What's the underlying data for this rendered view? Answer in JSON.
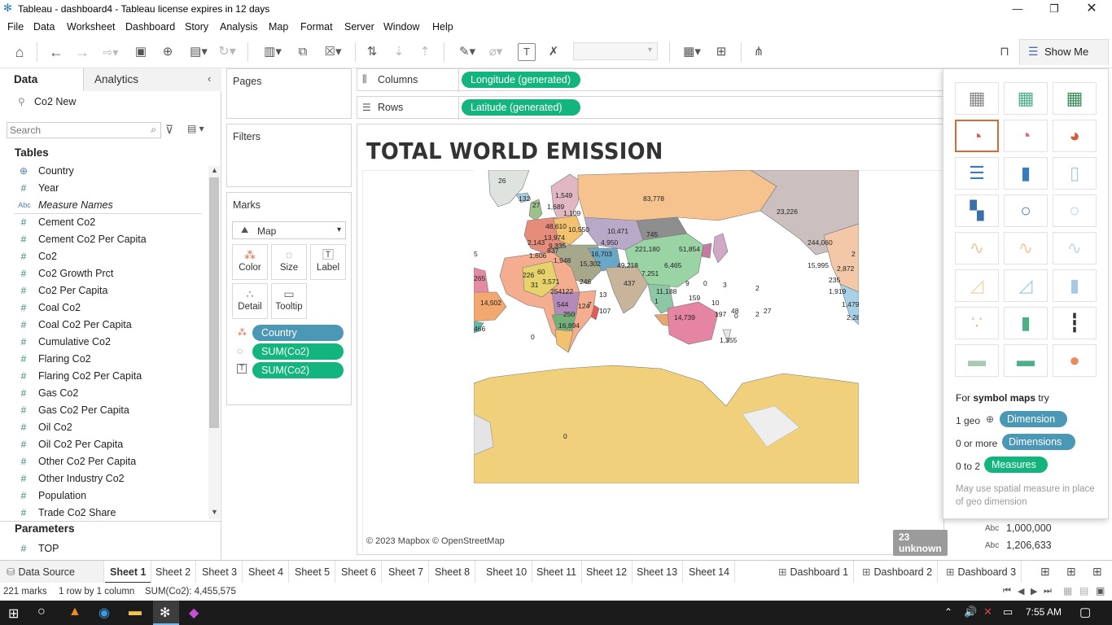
{
  "window": {
    "title": "Tableau - dashboard4 - Tableau license expires in 12 days"
  },
  "menu": [
    "File",
    "Data",
    "Worksheet",
    "Dashboard",
    "Story",
    "Analysis",
    "Map",
    "Format",
    "Server",
    "Window",
    "Help"
  ],
  "toolbar": {
    "show_me": "Show Me"
  },
  "data_pane": {
    "tab_data": "Data",
    "tab_analytics": "Analytics",
    "source": "Co2 New",
    "search_placeholder": "Search",
    "tables_header": "Tables",
    "fields": [
      {
        "type": "geo",
        "icon": "⊕",
        "name": "Country"
      },
      {
        "type": "num",
        "icon": "#",
        "name": "Year"
      },
      {
        "type": "abc",
        "icon": "Abc",
        "name": "Measure Names"
      },
      {
        "type": "num",
        "icon": "#",
        "name": "Cement Co2"
      },
      {
        "type": "num",
        "icon": "#",
        "name": "Cement Co2 Per Capita"
      },
      {
        "type": "num",
        "icon": "#",
        "name": "Co2"
      },
      {
        "type": "num",
        "icon": "#",
        "name": "Co2 Growth Prct"
      },
      {
        "type": "num",
        "icon": "#",
        "name": "Co2 Per Capita"
      },
      {
        "type": "num",
        "icon": "#",
        "name": "Coal Co2"
      },
      {
        "type": "num",
        "icon": "#",
        "name": "Coal Co2 Per Capita"
      },
      {
        "type": "num",
        "icon": "#",
        "name": "Cumulative Co2"
      },
      {
        "type": "num",
        "icon": "#",
        "name": "Flaring Co2"
      },
      {
        "type": "num",
        "icon": "#",
        "name": "Flaring Co2 Per Capita"
      },
      {
        "type": "num",
        "icon": "#",
        "name": "Gas Co2"
      },
      {
        "type": "num",
        "icon": "#",
        "name": "Gas Co2 Per Capita"
      },
      {
        "type": "num",
        "icon": "#",
        "name": "Oil Co2"
      },
      {
        "type": "num",
        "icon": "#",
        "name": "Oil Co2 Per Capita"
      },
      {
        "type": "num",
        "icon": "#",
        "name": "Other Co2 Per Capita"
      },
      {
        "type": "num",
        "icon": "#",
        "name": "Other Industry Co2"
      },
      {
        "type": "num",
        "icon": "#",
        "name": "Population"
      },
      {
        "type": "num",
        "icon": "#",
        "name": "Trade Co2 Share"
      }
    ],
    "parameters_header": "Parameters",
    "parameters": [
      {
        "icon": "#",
        "name": "TOP"
      }
    ]
  },
  "cards": {
    "pages": "Pages",
    "filters": "Filters",
    "marks": "Marks",
    "mark_type": "Map",
    "mark_buttons": [
      "Color",
      "Size",
      "Label",
      "Detail",
      "Tooltip"
    ],
    "mark_pills": [
      {
        "icon": "color",
        "label": "Country",
        "kind": "dimension"
      },
      {
        "icon": "size",
        "label": "SUM(Co2)",
        "kind": "measure"
      },
      {
        "icon": "label",
        "label": "SUM(Co2)",
        "kind": "measure"
      }
    ]
  },
  "shelves": {
    "columns_label": "Columns",
    "columns_pill": "Longitude (generated)",
    "rows_label": "Rows",
    "rows_pill": "Latitude (generated)"
  },
  "view": {
    "title": "TOTAL WORLD EMISSION",
    "attribution": "© 2023 Mapbox © OpenStreetMap",
    "unknown_badge": "23 unknown",
    "map_labels": [
      {
        "text": "26"
      },
      {
        "text": "132"
      },
      {
        "text": "27"
      },
      {
        "text": "1,689"
      },
      {
        "text": "1,549"
      },
      {
        "text": "1,109"
      },
      {
        "text": "83,778"
      },
      {
        "text": "23,226"
      },
      {
        "text": "48,610"
      },
      {
        "text": "10,550"
      },
      {
        "text": "13,974"
      },
      {
        "text": "2,143"
      },
      {
        "text": "9,335"
      },
      {
        "text": "10,471"
      },
      {
        "text": "745"
      },
      {
        "text": "4,950"
      },
      {
        "text": "221,180"
      },
      {
        "text": "51,854"
      },
      {
        "text": "244,060"
      },
      {
        "text": "1,606"
      },
      {
        "text": "16,703"
      },
      {
        "text": "15,302"
      },
      {
        "text": "49,218"
      },
      {
        "text": "6,465"
      },
      {
        "text": "15,995"
      },
      {
        "text": "2,872"
      },
      {
        "text": "837"
      },
      {
        "text": "1,948"
      },
      {
        "text": "60"
      },
      {
        "text": "226"
      },
      {
        "text": "3,571"
      },
      {
        "text": "31"
      },
      {
        "text": "246"
      },
      {
        "text": "7,251"
      },
      {
        "text": "437"
      },
      {
        "text": "254"
      },
      {
        "text": "122"
      },
      {
        "text": "13"
      },
      {
        "text": "11,188"
      },
      {
        "text": "9"
      },
      {
        "text": "0"
      },
      {
        "text": "3"
      },
      {
        "text": "235"
      },
      {
        "text": "1,919"
      },
      {
        "text": "265"
      },
      {
        "text": "14,502"
      },
      {
        "text": "544"
      },
      {
        "text": "124"
      },
      {
        "text": "7"
      },
      {
        "text": "1"
      },
      {
        "text": "159"
      },
      {
        "text": "10"
      },
      {
        "text": "2"
      },
      {
        "text": "1,479"
      },
      {
        "text": "250"
      },
      {
        "text": "107"
      },
      {
        "text": "14,739"
      },
      {
        "text": "197"
      },
      {
        "text": "48"
      },
      {
        "text": "0"
      },
      {
        "text": "2"
      },
      {
        "text": "27"
      },
      {
        "text": "2,28"
      },
      {
        "text": "16,894"
      },
      {
        "text": "466"
      },
      {
        "text": "0"
      },
      {
        "text": "1,355"
      },
      {
        "text": "0"
      },
      {
        "text": "5"
      },
      {
        "text": "2"
      }
    ]
  },
  "showme": {
    "hint_prefix": "For ",
    "hint_bold": "symbol maps",
    "hint_suffix": " try",
    "rows": [
      {
        "prefix": "1 geo",
        "pill": "Dimension"
      },
      {
        "prefix": "0 or more",
        "pill": "Dimensions"
      },
      {
        "prefix": "0 to 2",
        "pill": "Measures"
      }
    ],
    "note": "May use spatial measure in place of geo dimension"
  },
  "legend_peek": [
    {
      "icon": "Abc",
      "value": "1,000,000"
    },
    {
      "icon": "Abc",
      "value": "1,206,633"
    }
  ],
  "sheet_tabs": {
    "data_source": "Data Source",
    "sheets": [
      "Sheet 1",
      "Sheet 2",
      "Sheet 3",
      "Sheet 4",
      "Sheet 5",
      "Sheet 6",
      "Sheet 7",
      "Sheet 8",
      "Sheet 10",
      "Sheet 11",
      "Sheet 12",
      "Sheet 13",
      "Sheet 14"
    ],
    "dashboards": [
      "Dashboard 1",
      "Dashboard 2",
      "Dashboard 3"
    ],
    "active": "Sheet 1"
  },
  "status": {
    "marks": "221 marks",
    "dims": "1 row by 1 column",
    "sum": "SUM(Co2): 4,455,575"
  },
  "taskbar": {
    "time": "7:55 AM"
  }
}
